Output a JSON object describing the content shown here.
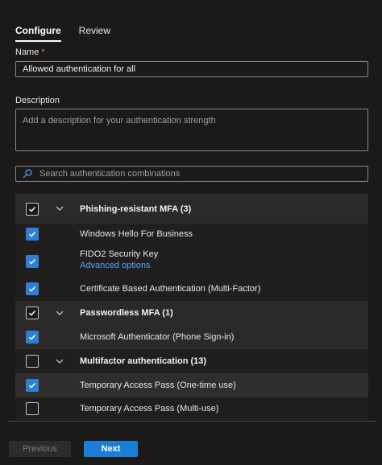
{
  "tabs": [
    {
      "label": "Configure",
      "active": true
    },
    {
      "label": "Review",
      "active": false
    }
  ],
  "form": {
    "name_label": "Name",
    "name_required_marker": "*",
    "name_value": "Allowed authentication for all",
    "description_label": "Description",
    "description_placeholder": "Add a description for your authentication strength",
    "search_placeholder": "Search authentication combinations"
  },
  "combinations": {
    "groups": [
      {
        "label": "Phishing-resistant MFA (3)",
        "checked": true,
        "items": [
          {
            "label": "Windows Hello For Business",
            "checked": true
          },
          {
            "label": "FIDO2 Security Key",
            "link": "Advanced options",
            "checked": true
          },
          {
            "label": "Certificate Based Authentication (Multi-Factor)",
            "checked": true
          }
        ]
      },
      {
        "label": "Passwordless MFA (1)",
        "checked": true,
        "items": [
          {
            "label": "Microsoft Authenticator (Phone Sign-in)",
            "checked": true
          }
        ]
      },
      {
        "label": "Multifactor authentication (13)",
        "checked": false,
        "items": [
          {
            "label": "Temporary Access Pass (One-time use)",
            "checked": true
          },
          {
            "label": "Temporary Access Pass (Multi-use)",
            "checked": false
          }
        ]
      }
    ]
  },
  "footer": {
    "previous_label": "Previous",
    "next_label": "Next"
  },
  "colors": {
    "accent": "#1a7fd4",
    "checkbox_checked": "#2f7fd6",
    "link": "#4fa3f7",
    "background": "#1b1a19"
  },
  "icons": {
    "search": "search-icon",
    "expand": "chevron-down-icon",
    "checked": "checkmark-icon"
  }
}
